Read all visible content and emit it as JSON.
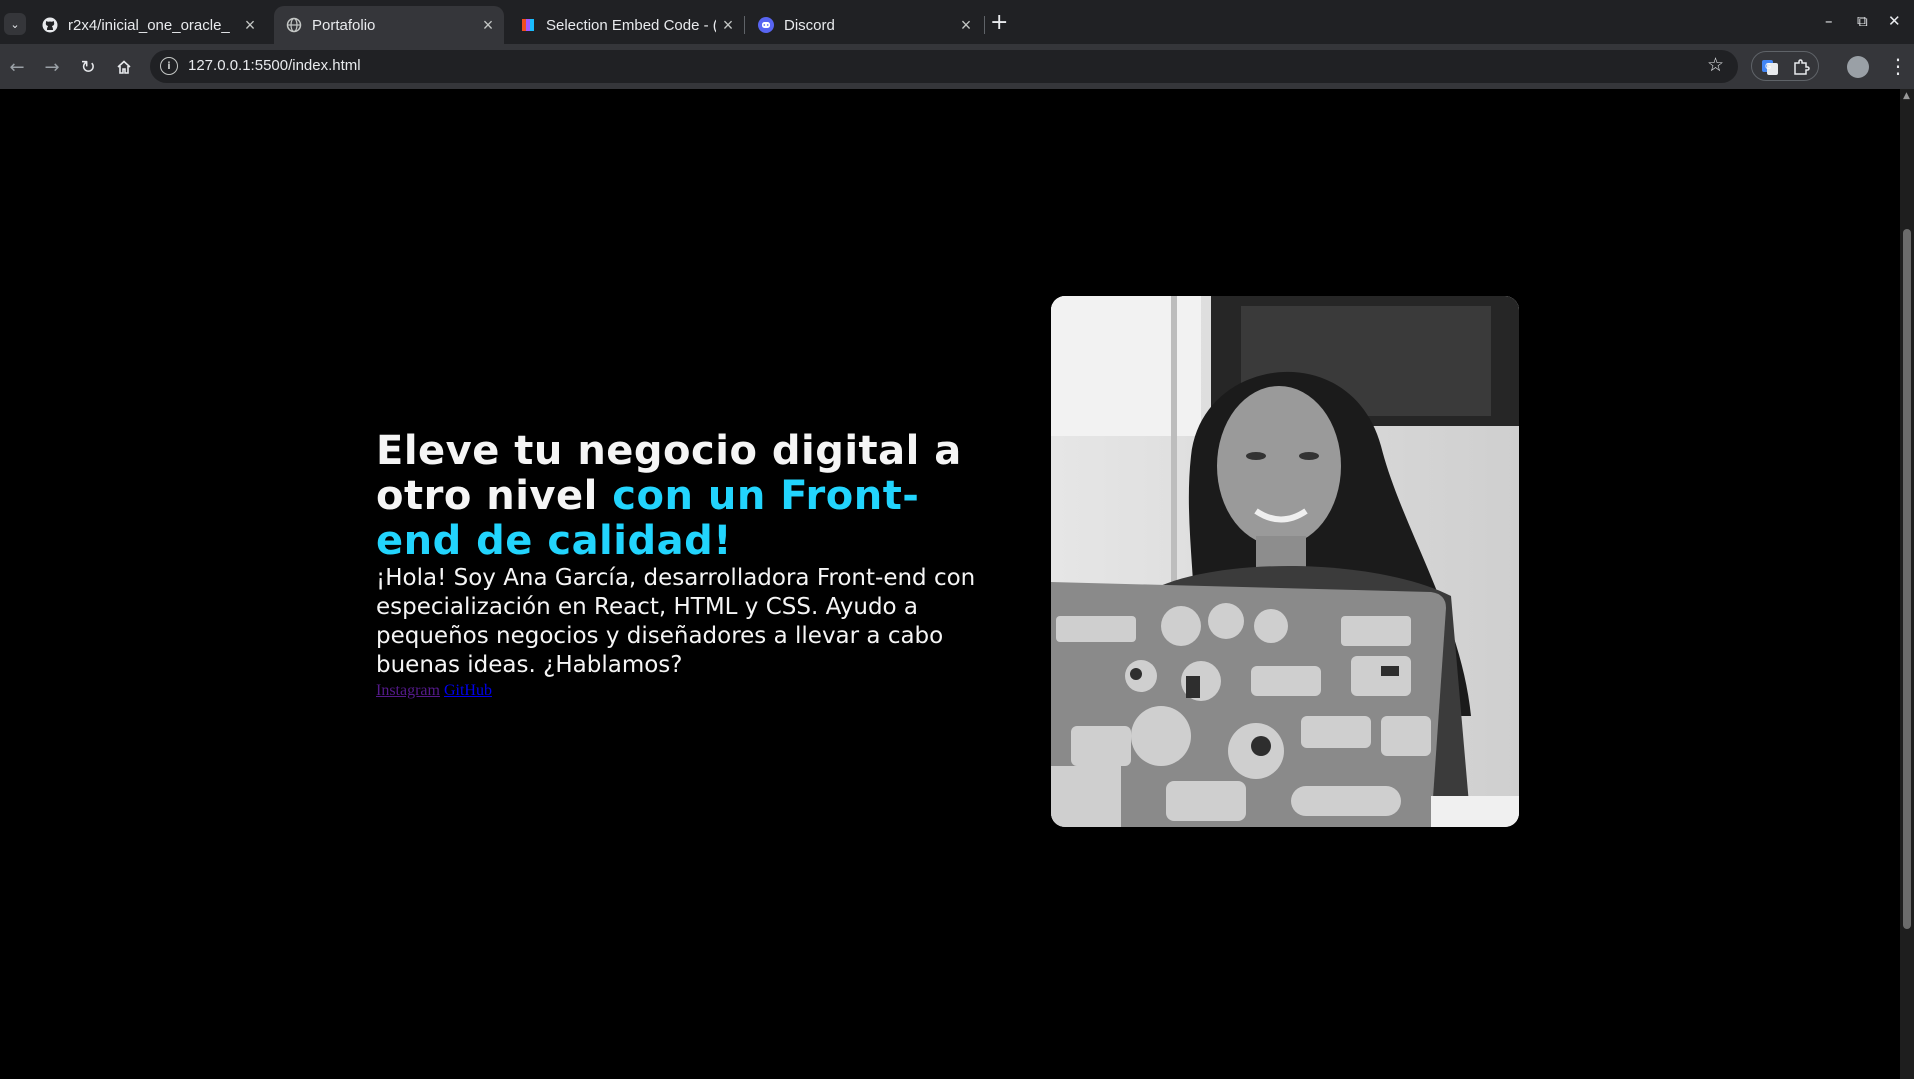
{
  "browser": {
    "tabs": [
      {
        "title": "r2x4/inicial_one_oracle_",
        "icon": "github-icon"
      },
      {
        "title": "Portafolio",
        "icon": "globe-icon",
        "active": true
      },
      {
        "title": "Selection Embed Code - (",
        "icon": "figma-icon"
      },
      {
        "title": "Discord",
        "icon": "discord-icon"
      }
    ],
    "url": "127.0.0.1:5500/index.html"
  },
  "page": {
    "title_white": "Eleve tu negocio digital a otro nivel ",
    "title_accent": "con un Front-end de calidad!",
    "description": "¡Hola! Soy Ana García, desarrolladora Front-end con especialización en React, HTML y CSS. Ayudo a pequeños negocios y diseñadores a llevar a cabo buenas ideas. ¿Hablamos?",
    "links": {
      "instagram": "Instagram",
      "github": "GitHub"
    },
    "photo_alt": "Woman smiling at laptop covered with stickers"
  },
  "colors": {
    "accent": "#22d4fd",
    "background": "#000000"
  }
}
